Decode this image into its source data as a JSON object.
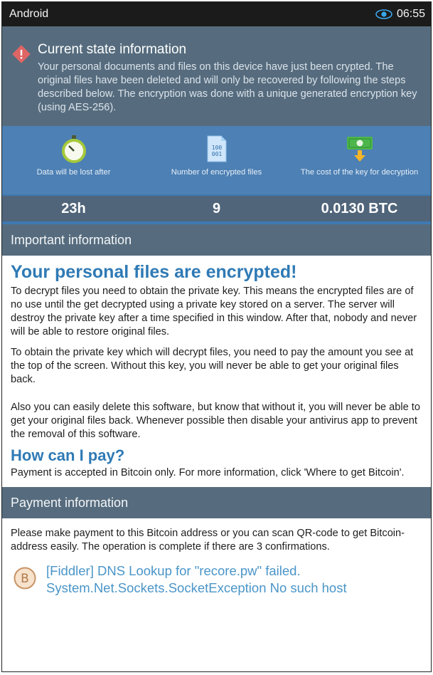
{
  "status_bar": {
    "title": "Android",
    "time": "06:55",
    "icon": "eye-icon"
  },
  "current_state": {
    "title": "Current state information",
    "body": "Your personal documents and files on this device have just been crypted. The original files have been deleted and will only be recovered by following the steps described below. The encryption was done with a unique generated encryption key (using AES-256).",
    "icon": "warning-diamond-icon",
    "accent": "#e06565"
  },
  "stats": [
    {
      "icon": "stopwatch-icon",
      "label": "Data will be lost after",
      "value": "23h"
    },
    {
      "icon": "binary-file-icon",
      "label": "Number of encrypted files",
      "value": "9"
    },
    {
      "icon": "money-icon",
      "label": "The cost of the key for decryption",
      "value": "0.0130 BTC"
    }
  ],
  "important": {
    "header": "Important information",
    "heading": "Your personal files are encrypted!",
    "paragraphs": [
      "To decrypt files you need to obtain the private key. This means the encrypted files are of no use until the get decrypted using a private key stored on a server. The server will destroy the private key after a time specified in this window. After that, nobody and never will be able to restore original files.",
      "To obtain the private key which will decrypt files, you need to pay the amount you see at the top of the screen. Without this key, you will never be able to get your original files back.",
      "Also you can easily delete this software, but know that without it, you will never be able to get your original files back. Whenever possible then disable your antivirus app to prevent the removal of this software."
    ],
    "pay_heading": "How can I pay?",
    "pay_text": "Payment is accepted in Bitcoin only. For more information, click 'Where to get Bitcoin'."
  },
  "payment": {
    "header": "Payment information",
    "instructions": "Please make payment to this Bitcoin address or you can scan QR-code to get Bitcoin-address easily. The operation is complete if there are 3 confirmations.",
    "error_line1": "[Fiddler] DNS Lookup for \"recore.pw\" failed.",
    "error_line2": "System.Net.Sockets.SocketException No such host",
    "icon": "bitcoin-icon"
  },
  "colors": {
    "header_bg": "#566c7e",
    "stats_bg": "#4d80b4",
    "link_blue": "#2f7ab5"
  }
}
